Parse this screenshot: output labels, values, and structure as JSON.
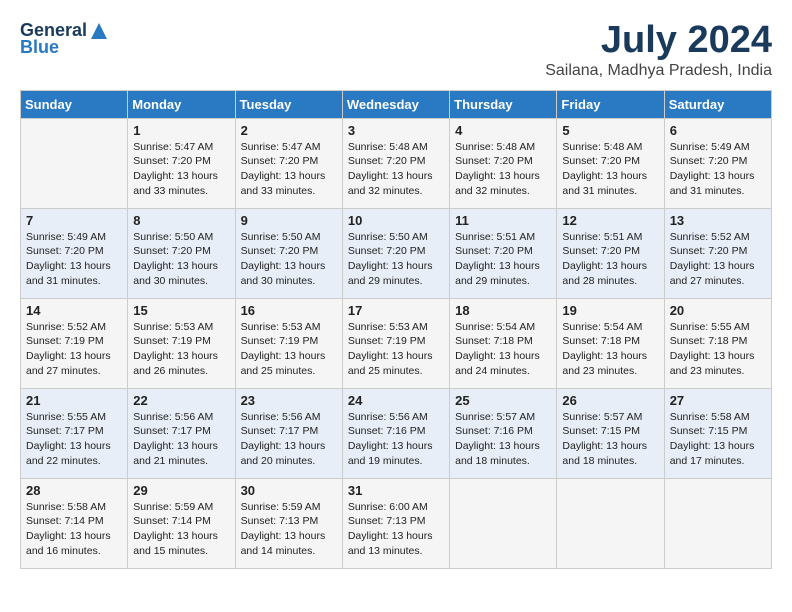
{
  "logo": {
    "general": "General",
    "blue": "Blue"
  },
  "title": {
    "month_year": "July 2024",
    "location": "Sailana, Madhya Pradesh, India"
  },
  "days_header": [
    "Sunday",
    "Monday",
    "Tuesday",
    "Wednesday",
    "Thursday",
    "Friday",
    "Saturday"
  ],
  "weeks": [
    [
      {
        "day": "",
        "content": ""
      },
      {
        "day": "1",
        "content": "Sunrise: 5:47 AM\nSunset: 7:20 PM\nDaylight: 13 hours\nand 33 minutes."
      },
      {
        "day": "2",
        "content": "Sunrise: 5:47 AM\nSunset: 7:20 PM\nDaylight: 13 hours\nand 33 minutes."
      },
      {
        "day": "3",
        "content": "Sunrise: 5:48 AM\nSunset: 7:20 PM\nDaylight: 13 hours\nand 32 minutes."
      },
      {
        "day": "4",
        "content": "Sunrise: 5:48 AM\nSunset: 7:20 PM\nDaylight: 13 hours\nand 32 minutes."
      },
      {
        "day": "5",
        "content": "Sunrise: 5:48 AM\nSunset: 7:20 PM\nDaylight: 13 hours\nand 31 minutes."
      },
      {
        "day": "6",
        "content": "Sunrise: 5:49 AM\nSunset: 7:20 PM\nDaylight: 13 hours\nand 31 minutes."
      }
    ],
    [
      {
        "day": "7",
        "content": "Sunrise: 5:49 AM\nSunset: 7:20 PM\nDaylight: 13 hours\nand 31 minutes."
      },
      {
        "day": "8",
        "content": "Sunrise: 5:50 AM\nSunset: 7:20 PM\nDaylight: 13 hours\nand 30 minutes."
      },
      {
        "day": "9",
        "content": "Sunrise: 5:50 AM\nSunset: 7:20 PM\nDaylight: 13 hours\nand 30 minutes."
      },
      {
        "day": "10",
        "content": "Sunrise: 5:50 AM\nSunset: 7:20 PM\nDaylight: 13 hours\nand 29 minutes."
      },
      {
        "day": "11",
        "content": "Sunrise: 5:51 AM\nSunset: 7:20 PM\nDaylight: 13 hours\nand 29 minutes."
      },
      {
        "day": "12",
        "content": "Sunrise: 5:51 AM\nSunset: 7:20 PM\nDaylight: 13 hours\nand 28 minutes."
      },
      {
        "day": "13",
        "content": "Sunrise: 5:52 AM\nSunset: 7:20 PM\nDaylight: 13 hours\nand 27 minutes."
      }
    ],
    [
      {
        "day": "14",
        "content": "Sunrise: 5:52 AM\nSunset: 7:19 PM\nDaylight: 13 hours\nand 27 minutes."
      },
      {
        "day": "15",
        "content": "Sunrise: 5:53 AM\nSunset: 7:19 PM\nDaylight: 13 hours\nand 26 minutes."
      },
      {
        "day": "16",
        "content": "Sunrise: 5:53 AM\nSunset: 7:19 PM\nDaylight: 13 hours\nand 25 minutes."
      },
      {
        "day": "17",
        "content": "Sunrise: 5:53 AM\nSunset: 7:19 PM\nDaylight: 13 hours\nand 25 minutes."
      },
      {
        "day": "18",
        "content": "Sunrise: 5:54 AM\nSunset: 7:18 PM\nDaylight: 13 hours\nand 24 minutes."
      },
      {
        "day": "19",
        "content": "Sunrise: 5:54 AM\nSunset: 7:18 PM\nDaylight: 13 hours\nand 23 minutes."
      },
      {
        "day": "20",
        "content": "Sunrise: 5:55 AM\nSunset: 7:18 PM\nDaylight: 13 hours\nand 23 minutes."
      }
    ],
    [
      {
        "day": "21",
        "content": "Sunrise: 5:55 AM\nSunset: 7:17 PM\nDaylight: 13 hours\nand 22 minutes."
      },
      {
        "day": "22",
        "content": "Sunrise: 5:56 AM\nSunset: 7:17 PM\nDaylight: 13 hours\nand 21 minutes."
      },
      {
        "day": "23",
        "content": "Sunrise: 5:56 AM\nSunset: 7:17 PM\nDaylight: 13 hours\nand 20 minutes."
      },
      {
        "day": "24",
        "content": "Sunrise: 5:56 AM\nSunset: 7:16 PM\nDaylight: 13 hours\nand 19 minutes."
      },
      {
        "day": "25",
        "content": "Sunrise: 5:57 AM\nSunset: 7:16 PM\nDaylight: 13 hours\nand 18 minutes."
      },
      {
        "day": "26",
        "content": "Sunrise: 5:57 AM\nSunset: 7:15 PM\nDaylight: 13 hours\nand 18 minutes."
      },
      {
        "day": "27",
        "content": "Sunrise: 5:58 AM\nSunset: 7:15 PM\nDaylight: 13 hours\nand 17 minutes."
      }
    ],
    [
      {
        "day": "28",
        "content": "Sunrise: 5:58 AM\nSunset: 7:14 PM\nDaylight: 13 hours\nand 16 minutes."
      },
      {
        "day": "29",
        "content": "Sunrise: 5:59 AM\nSunset: 7:14 PM\nDaylight: 13 hours\nand 15 minutes."
      },
      {
        "day": "30",
        "content": "Sunrise: 5:59 AM\nSunset: 7:13 PM\nDaylight: 13 hours\nand 14 minutes."
      },
      {
        "day": "31",
        "content": "Sunrise: 6:00 AM\nSunset: 7:13 PM\nDaylight: 13 hours\nand 13 minutes."
      },
      {
        "day": "",
        "content": ""
      },
      {
        "day": "",
        "content": ""
      },
      {
        "day": "",
        "content": ""
      }
    ]
  ]
}
